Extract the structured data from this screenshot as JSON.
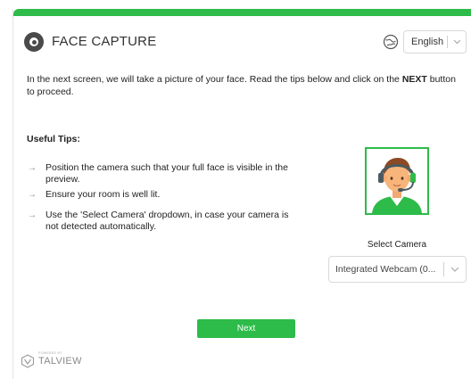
{
  "header": {
    "title": "FACE CAPTURE",
    "language": "English",
    "icons": {
      "logo": "webcam-icon",
      "language": "globe-icon",
      "dropdown": "chevron-down-icon"
    }
  },
  "intro": {
    "text_before": "In the next screen, we will take a picture of your face. Read the tips below and click on the ",
    "emphasis": "NEXT",
    "text_after": " button to proceed."
  },
  "tips": {
    "heading": "Useful Tips:",
    "items": [
      "Position the camera such that your full face is visible in the preview.",
      "Ensure your room is well lit.",
      "Use the 'Select Camera' dropdown, in case your camera is not detected automatically."
    ]
  },
  "camera": {
    "label": "Select Camera",
    "selected": "Integrated Webcam (0..."
  },
  "actions": {
    "next_label": "Next"
  },
  "footer": {
    "powered_by": "POWERED BY",
    "brand": "TALVIEW"
  },
  "colors": {
    "accent": "#2dbb49",
    "text": "#222222",
    "border": "#d9d9d9"
  }
}
